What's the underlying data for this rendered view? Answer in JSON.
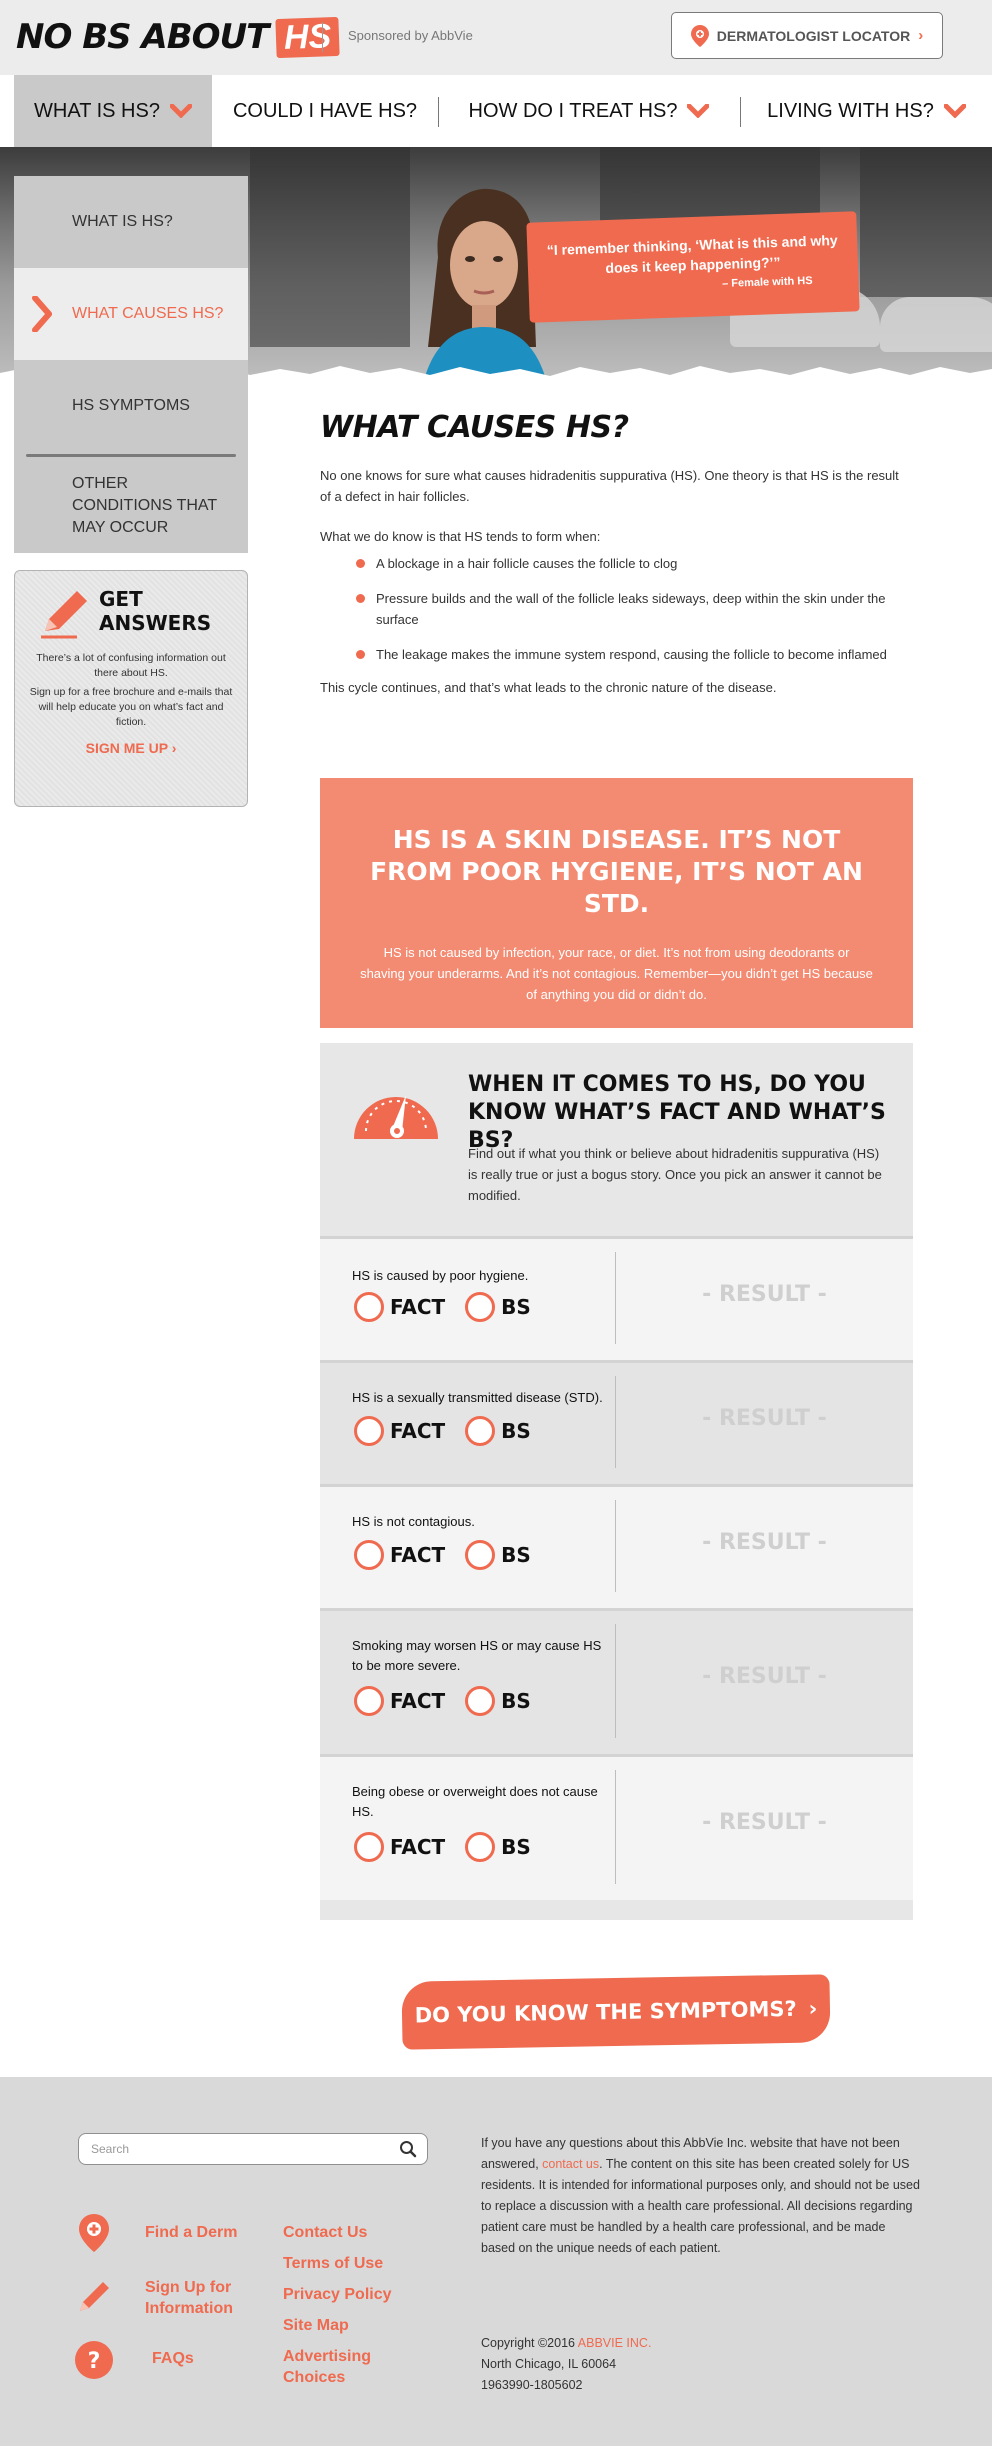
{
  "header": {
    "logo_text": "NO BS ABOUT",
    "logo_hs": "HS",
    "sponsor": "Sponsored by AbbVie",
    "locator_label": "DERMATOLOGIST LOCATOR",
    "locator_chevron": "›"
  },
  "nav": {
    "items": [
      {
        "label": "WHAT IS HS?",
        "has_dropdown": true,
        "active": true
      },
      {
        "label": "COULD I HAVE HS?",
        "has_dropdown": false
      },
      {
        "label": "HOW DO I TREAT HS?",
        "has_dropdown": true
      },
      {
        "label": "LIVING WITH HS?",
        "has_dropdown": true
      }
    ]
  },
  "hero": {
    "quote_open": "“",
    "quote": "I remember thinking, ‘What is this and why does it keep happening?’",
    "quote_close": "”",
    "attribution": "– Female with HS"
  },
  "sidebar": {
    "items": [
      {
        "label": "WHAT IS HS?"
      },
      {
        "label": "WHAT CAUSES HS?",
        "active": true
      },
      {
        "label": "HS SYMPTOMS"
      },
      {
        "label": "OTHER CONDITIONS THAT MAY OCCUR"
      }
    ],
    "answers": {
      "title": "GET ANSWERS",
      "text1": "There’s a lot of confusing information out there about HS.",
      "text2": "Sign up for a free brochure and e-mails that will help educate you on what’s fact and fiction.",
      "link": "SIGN ME UP ›"
    }
  },
  "main": {
    "title": "WHAT CAUSES HS?",
    "intro": "No one knows for sure what causes hidradenitis suppurativa (HS). One theory is that HS is the result of a defect in hair follicles.",
    "lead": "What we do know is that HS tends to form when:",
    "bullets": [
      "A blockage in a hair follicle causes the follicle to clog",
      "Pressure builds and the wall of the follicle leaks sideways, deep within the skin under the surface",
      "The leakage makes the immune system respond, causing the follicle to become inflamed"
    ],
    "conclusion": "This cycle continues, and that’s what leads to the chronic nature of the disease."
  },
  "callout": {
    "heading": "HS IS A SKIN DISEASE. IT’S NOT FROM POOR HYGIENE, IT’S NOT AN STD.",
    "body": "HS is not caused by infection, your race, or diet. It’s not from using deodorants or shaving your underarms. And it’s not contagious. Remember—you didn’t get HS because of anything you did or didn’t do."
  },
  "quiz": {
    "title": "WHEN IT COMES TO HS, DO YOU KNOW WHAT’S FACT AND WHAT’S BS?",
    "description": "Find out if what you think or believe about hidradenitis suppurativa (HS) is really true or just a bogus story. Once you pick an answer it cannot be modified.",
    "fact_label": "FACT",
    "bs_label": "BS",
    "result_label": "- RESULT -",
    "questions": [
      {
        "text": "HS is caused by poor hygiene."
      },
      {
        "text": "HS is a sexually transmitted disease (STD)."
      },
      {
        "text": "HS is not contagious."
      },
      {
        "text": "Smoking may worsen HS or may cause HS to be more severe."
      },
      {
        "text": "Being obese or overweight does not cause HS."
      }
    ]
  },
  "symptoms_button": {
    "label": "DO YOU KNOW THE SYMPTOMS?",
    "chevron": "›"
  },
  "footer": {
    "search_placeholder": "Search",
    "icon_links": [
      {
        "label": "Find a Derm",
        "icon": "map-pin-icon"
      },
      {
        "label": "Sign Up for Information",
        "icon": "pencil-icon"
      },
      {
        "label": "FAQs",
        "icon": "question-icon"
      }
    ],
    "links": [
      "Contact Us",
      "Terms of Use",
      "Privacy Policy",
      "Site Map",
      "Advertising Choices"
    ],
    "disclaimer_pre": "If you have any questions about this AbbVie Inc. website that have not been answered, ",
    "disclaimer_link": "contact us",
    "disclaimer_post": ". The content on this site has been created solely for US residents. It is intended for informational purposes only, and should not be used to replace a discussion with a health care professional. All decisions regarding patient care must be handled by a health care professional, and be made based on the unique needs of each patient.",
    "copyright_pre": "Copyright ©2016 ",
    "copyright_company": "ABBVIE INC.",
    "address": "North Chicago, IL 60064",
    "code": "1963990-1805602"
  },
  "colors": {
    "accent": "#ef6a4f",
    "accent_light": "#f38b73",
    "nav_active": "#c9c9c9",
    "footer_bg": "#d9d9d9"
  }
}
